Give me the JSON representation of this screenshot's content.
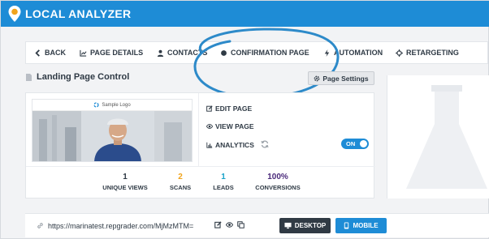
{
  "app": {
    "title": "LOCAL ANALYZER"
  },
  "nav": {
    "items": [
      {
        "label": "BACK",
        "icon": "chevron-left-icon"
      },
      {
        "label": "PAGE DETAILS",
        "icon": "chart-icon"
      },
      {
        "label": "CONTACTS",
        "icon": "user-icon"
      },
      {
        "label": "CONFIRMATION PAGE",
        "icon": "circle-icon"
      },
      {
        "label": "AUTOMATION",
        "icon": "bolt-icon"
      },
      {
        "label": "RETARGETING",
        "icon": "crosshair-icon"
      }
    ]
  },
  "section": {
    "title": "Landing Page Control",
    "settings_label": "Page Settings"
  },
  "preview": {
    "logo_text": "Sample Logo"
  },
  "actions": {
    "edit": "EDIT PAGE",
    "view": "VIEW PAGE",
    "analytics": "ANALYTICS"
  },
  "toggle": {
    "label": "ON",
    "state": true
  },
  "stats": [
    {
      "value": "1",
      "label": "UNIQUE VIEWS",
      "color": "#2f3a45"
    },
    {
      "value": "2",
      "label": "SCANS",
      "color": "#f0a31c"
    },
    {
      "value": "1",
      "label": "LEADS",
      "color": "#1aa3c9"
    },
    {
      "value": "100%",
      "label": "CONVERSIONS",
      "color": "#4b2a7b"
    }
  ],
  "url": {
    "text": "https://marinatest.repgrader.com/MjMzMTM="
  },
  "buttons": {
    "desktop": "DESKTOP",
    "mobile": "MOBILE"
  },
  "colors": {
    "brand": "#1e8cd6",
    "dark": "#303a44"
  }
}
